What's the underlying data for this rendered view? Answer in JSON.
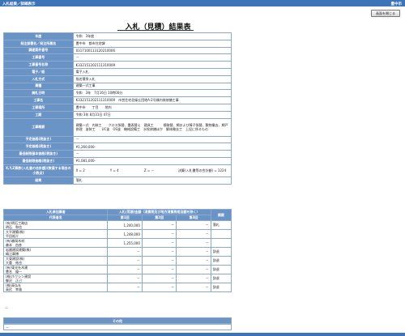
{
  "header": {
    "left": "入札結果／詳細表示",
    "right": "豊中市"
  },
  "close_button": "画面を閉じる",
  "title": "入札（見積）結果表",
  "info_rows": [
    {
      "label": "年度",
      "value": "令和　3年度"
    },
    {
      "label": "発注部署名／発注所属名",
      "value": "豊中市　都市住宅課"
    },
    {
      "label": "調達案件番号",
      "value": "0317100113120210006"
    },
    {
      "label": "工事番号",
      "value": "－"
    },
    {
      "label": "工事番号名称",
      "value": "K332151202111310009"
    },
    {
      "label": "電子／紙",
      "value": "電子入札"
    },
    {
      "label": "入札方式",
      "value": "指名競争入札"
    },
    {
      "label": "業種",
      "value": "建築一式工事"
    },
    {
      "label": "開札日時",
      "value": "令和　3年　7月16日 10時00分"
    },
    {
      "label": "工事名",
      "value": "K332151202111310009　市営住宅北緑丘団地A-2号棟内装修繕工事"
    },
    {
      "label": "工事場所",
      "value": "豊中市　　丁目　　地内"
    },
    {
      "label": "工期",
      "value": "令和 3年 8月31日 47日"
    },
    {
      "label": "工事概要",
      "value": "建築一式　内装工　　クロス張替、畳表替え　建具工　　　襖取替、網および障子張替、敷物撤去、網戸修理　塗装工　　UC塗　OS塗　機械設備工　水栓修繕ほか　解体撤去工　上記に係るもの"
    },
    {
      "label": "予定価格(税抜き)",
      "value": "－"
    },
    {
      "label": "予定価格(税抜き)",
      "value": "¥1,260,000-"
    },
    {
      "label": "最低制限基本価格(税抜き)",
      "value": "－"
    },
    {
      "label": "最低制限価格(税抜き)",
      "value": "¥1,081,000-"
    },
    {
      "label": "X,Y,Z算数(入札書の合計額)(数値する場合の小数点)",
      "value": ""
    },
    {
      "label": "結果",
      "value": "落札"
    }
  ],
  "xyz": {
    "x": "X = 2",
    "y": "Y = 4",
    "z": "Z = －",
    "total": "決算(入札書等の合計額) = 1224"
  },
  "bids": {
    "col_bidder": "入札参加業者",
    "col_amounts": "入札(見積)金額（消費税及び地方消費税相当額を除く）",
    "col_remarks": "摘要",
    "col_rep": "代表者名",
    "round1": "第1回",
    "round2": "第2回",
    "round3": "第3回",
    "rows": [
      {
        "name": "(有)明石工務店",
        "rep": "明石　和也",
        "r1": "1,240,000",
        "r2": "－",
        "r3": "－",
        "remark": "落札"
      },
      {
        "name": "大平建築(株)",
        "rep": "平田裕介",
        "r1": "1,248,000",
        "r2": "－",
        "r3": "－",
        "remark": ""
      },
      {
        "name": "(有)森岡木材",
        "rep": "森本　由彦",
        "r1": "1,255,000",
        "r2": "－",
        "r3": "－",
        "remark": ""
      },
      {
        "name": "岩國建設建築(株)",
        "rep": "嶋江章博",
        "r1": "－",
        "r2": "－",
        "r3": "－",
        "remark": "辞退"
      },
      {
        "name": "大東建設(株)",
        "rep": "大重　祐也",
        "r1": "－",
        "r2": "－",
        "r3": "－",
        "remark": "辞退"
      },
      {
        "name": "(有)東光社木建",
        "rep": "豊名　優一",
        "r1": "－",
        "r2": "－",
        "r3": "－",
        "remark": "辞退"
      },
      {
        "name": "(株)ホクシン建設",
        "rep": "御沢　正己",
        "r1": "－",
        "r2": "－",
        "r3": "－",
        "remark": "辞退"
      },
      {
        "name": "(株)高弘社",
        "rep": "高尻　幸雄",
        "r1": "－",
        "r2": "－",
        "r3": "－",
        "remark": "辞退"
      }
    ]
  },
  "after_bids": "－",
  "other_header": "その他",
  "other_body": "－",
  "colors": {
    "bar": "#3d74b8",
    "label_bg": "#6a93c6",
    "border": "#8ca9cc"
  }
}
